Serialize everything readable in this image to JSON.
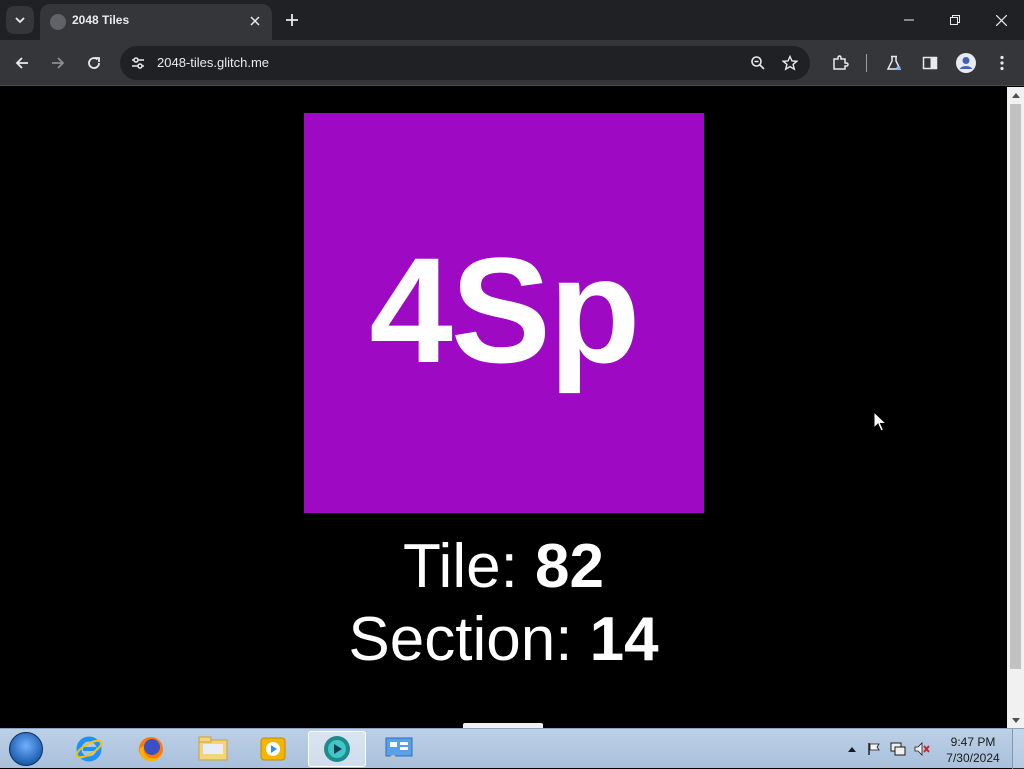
{
  "browser": {
    "tab": {
      "title": "2048 Tiles",
      "favicon": "globe-icon"
    },
    "url": "2048-tiles.glitch.me",
    "icons": {
      "back": "arrow-left-icon",
      "forward": "arrow-right-icon",
      "reload": "reload-icon",
      "site_info": "tune-icon",
      "zoom": "zoom-icon",
      "bookmark": "star-icon",
      "extensions": "puzzle-icon",
      "labs": "flask-icon",
      "side_panel": "side-panel-icon",
      "profile": "avatar-icon",
      "menu": "kebab-menu-icon"
    }
  },
  "page": {
    "tile_text": "4Sp",
    "tile_color": "#9e0ac3",
    "tile_label": "Tile: ",
    "tile_value": "82",
    "section_label": "Section: ",
    "section_value": "14"
  },
  "taskbar": {
    "apps": [
      "internet-explorer-icon",
      "firefox-icon",
      "file-explorer-icon",
      "media-player-icon",
      "active-app-icon",
      "control-panel-icon"
    ],
    "time": "9:47 PM",
    "date": "7/30/2024"
  }
}
